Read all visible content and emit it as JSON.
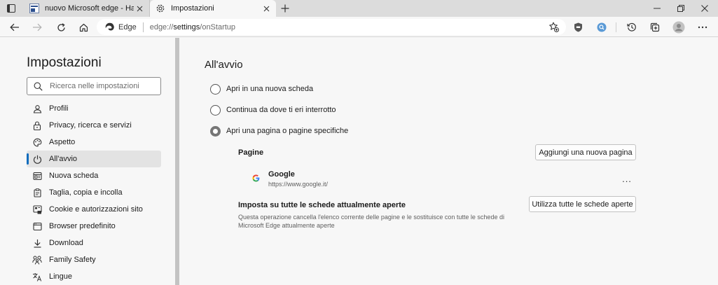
{
  "tabs": [
    {
      "title": "nuovo Microsoft edge - Hardware",
      "favicon": "hardware-site-icon",
      "active": false
    },
    {
      "title": "Impostazioni",
      "favicon": "gear-icon",
      "active": true
    }
  ],
  "toolbar": {
    "site_label": "Edge",
    "url_prefix": "edge://",
    "url_host": "settings",
    "url_path": "/onStartup"
  },
  "sidebar": {
    "title": "Impostazioni",
    "search_placeholder": "Ricerca nelle impostazioni",
    "items": [
      {
        "label": "Profili",
        "icon": "profile-icon"
      },
      {
        "label": "Privacy, ricerca e servizi",
        "icon": "lock-icon"
      },
      {
        "label": "Aspetto",
        "icon": "appearance-icon"
      },
      {
        "label": "All'avvio",
        "icon": "power-icon",
        "active": true
      },
      {
        "label": "Nuova scheda",
        "icon": "new-tab-icon"
      },
      {
        "label": "Taglia, copia e incolla",
        "icon": "clipboard-icon"
      },
      {
        "label": "Cookie e autorizzazioni sito",
        "icon": "site-permissions-icon"
      },
      {
        "label": "Browser predefinito",
        "icon": "browser-icon"
      },
      {
        "label": "Download",
        "icon": "download-icon"
      },
      {
        "label": "Family Safety",
        "icon": "family-icon"
      },
      {
        "label": "Lingue",
        "icon": "language-icon"
      }
    ]
  },
  "main": {
    "title": "All'avvio",
    "options": [
      {
        "label": "Apri in una nuova scheda",
        "checked": false
      },
      {
        "label": "Continua da dove ti eri interrotto",
        "checked": false
      },
      {
        "label": "Apri una pagina o pagine specifiche",
        "checked": true
      }
    ],
    "pages_label": "Pagine",
    "add_page_button": "Aggiungi una nuova pagina",
    "page": {
      "name": "Google",
      "url": "https://www.google.it/"
    },
    "more_label": "...",
    "set_all_title": "Imposta su tutte le schede attualmente aperte",
    "set_all_desc": "Questa operazione cancella l'elenco corrente delle pagine e le sostituisce con tutte le schede di Microsoft Edge attualmente aperte",
    "use_all_button": "Utilizza tutte le schede aperte"
  },
  "colors": {
    "accent": "#0f6cbd",
    "background": "#f7f7f7",
    "tabstrip": "#dcdcdc"
  }
}
